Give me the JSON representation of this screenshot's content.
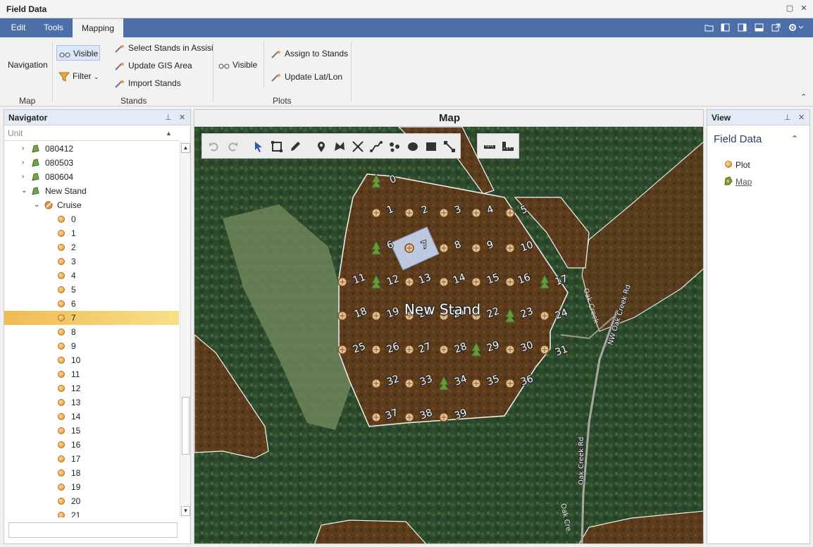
{
  "window": {
    "title": "Field Data"
  },
  "menu": {
    "tabs": [
      "Edit",
      "Tools",
      "Mapping"
    ],
    "active": "Mapping"
  },
  "ribbon": {
    "map_group": {
      "label": "Map",
      "navigation_label": "Navigation"
    },
    "stands_group": {
      "label": "Stands",
      "visible_label": "Visible",
      "filter_label": "Filter",
      "select_stands_label": "Select Stands in Assisi",
      "update_gis_label": "Update GIS Area",
      "import_stands_label": "Import Stands"
    },
    "plots_group": {
      "label": "Plots",
      "visible_label": "Visible",
      "assign_label": "Assign to Stands",
      "update_latlon_label": "Update Lat/Lon"
    }
  },
  "navigator": {
    "title": "Navigator",
    "column_header": "Unit",
    "folders": [
      "080412",
      "080503",
      "080604",
      "New Stand"
    ],
    "cruise_label": "Cruise",
    "plots": [
      "0",
      "1",
      "2",
      "3",
      "4",
      "5",
      "6",
      "7",
      "8",
      "9",
      "10",
      "11",
      "12",
      "13",
      "14",
      "15",
      "16",
      "17",
      "18",
      "19",
      "20",
      "21"
    ],
    "selected_plot": "7",
    "search_value": ""
  },
  "map": {
    "title": "Map",
    "stand_label": "New Stand",
    "road_labels": [
      "NW Oak Creek Rd",
      "Oak Creek",
      "Oak Creek Rd",
      "Oak Cre"
    ],
    "plot_labels": [
      "0",
      "1",
      "2",
      "3",
      "4",
      "5",
      "6",
      "7",
      "8",
      "9",
      "10",
      "11",
      "12",
      "13",
      "14",
      "15",
      "16",
      "17",
      "18",
      "19",
      "20",
      "21",
      "22",
      "23",
      "24",
      "25",
      "26",
      "27",
      "28",
      "29",
      "30",
      "31",
      "32",
      "33",
      "34",
      "35",
      "36",
      "37",
      "38",
      "39"
    ],
    "selected_plot": "7",
    "colors": {
      "stand_fill": "#5b3a1a",
      "forest": "#2f4a2c",
      "clearing": "#6f8a5c",
      "selection": "#c9d8f5"
    }
  },
  "view": {
    "title": "View",
    "section_title": "Field Data",
    "items": [
      "Plot",
      "Map"
    ]
  }
}
